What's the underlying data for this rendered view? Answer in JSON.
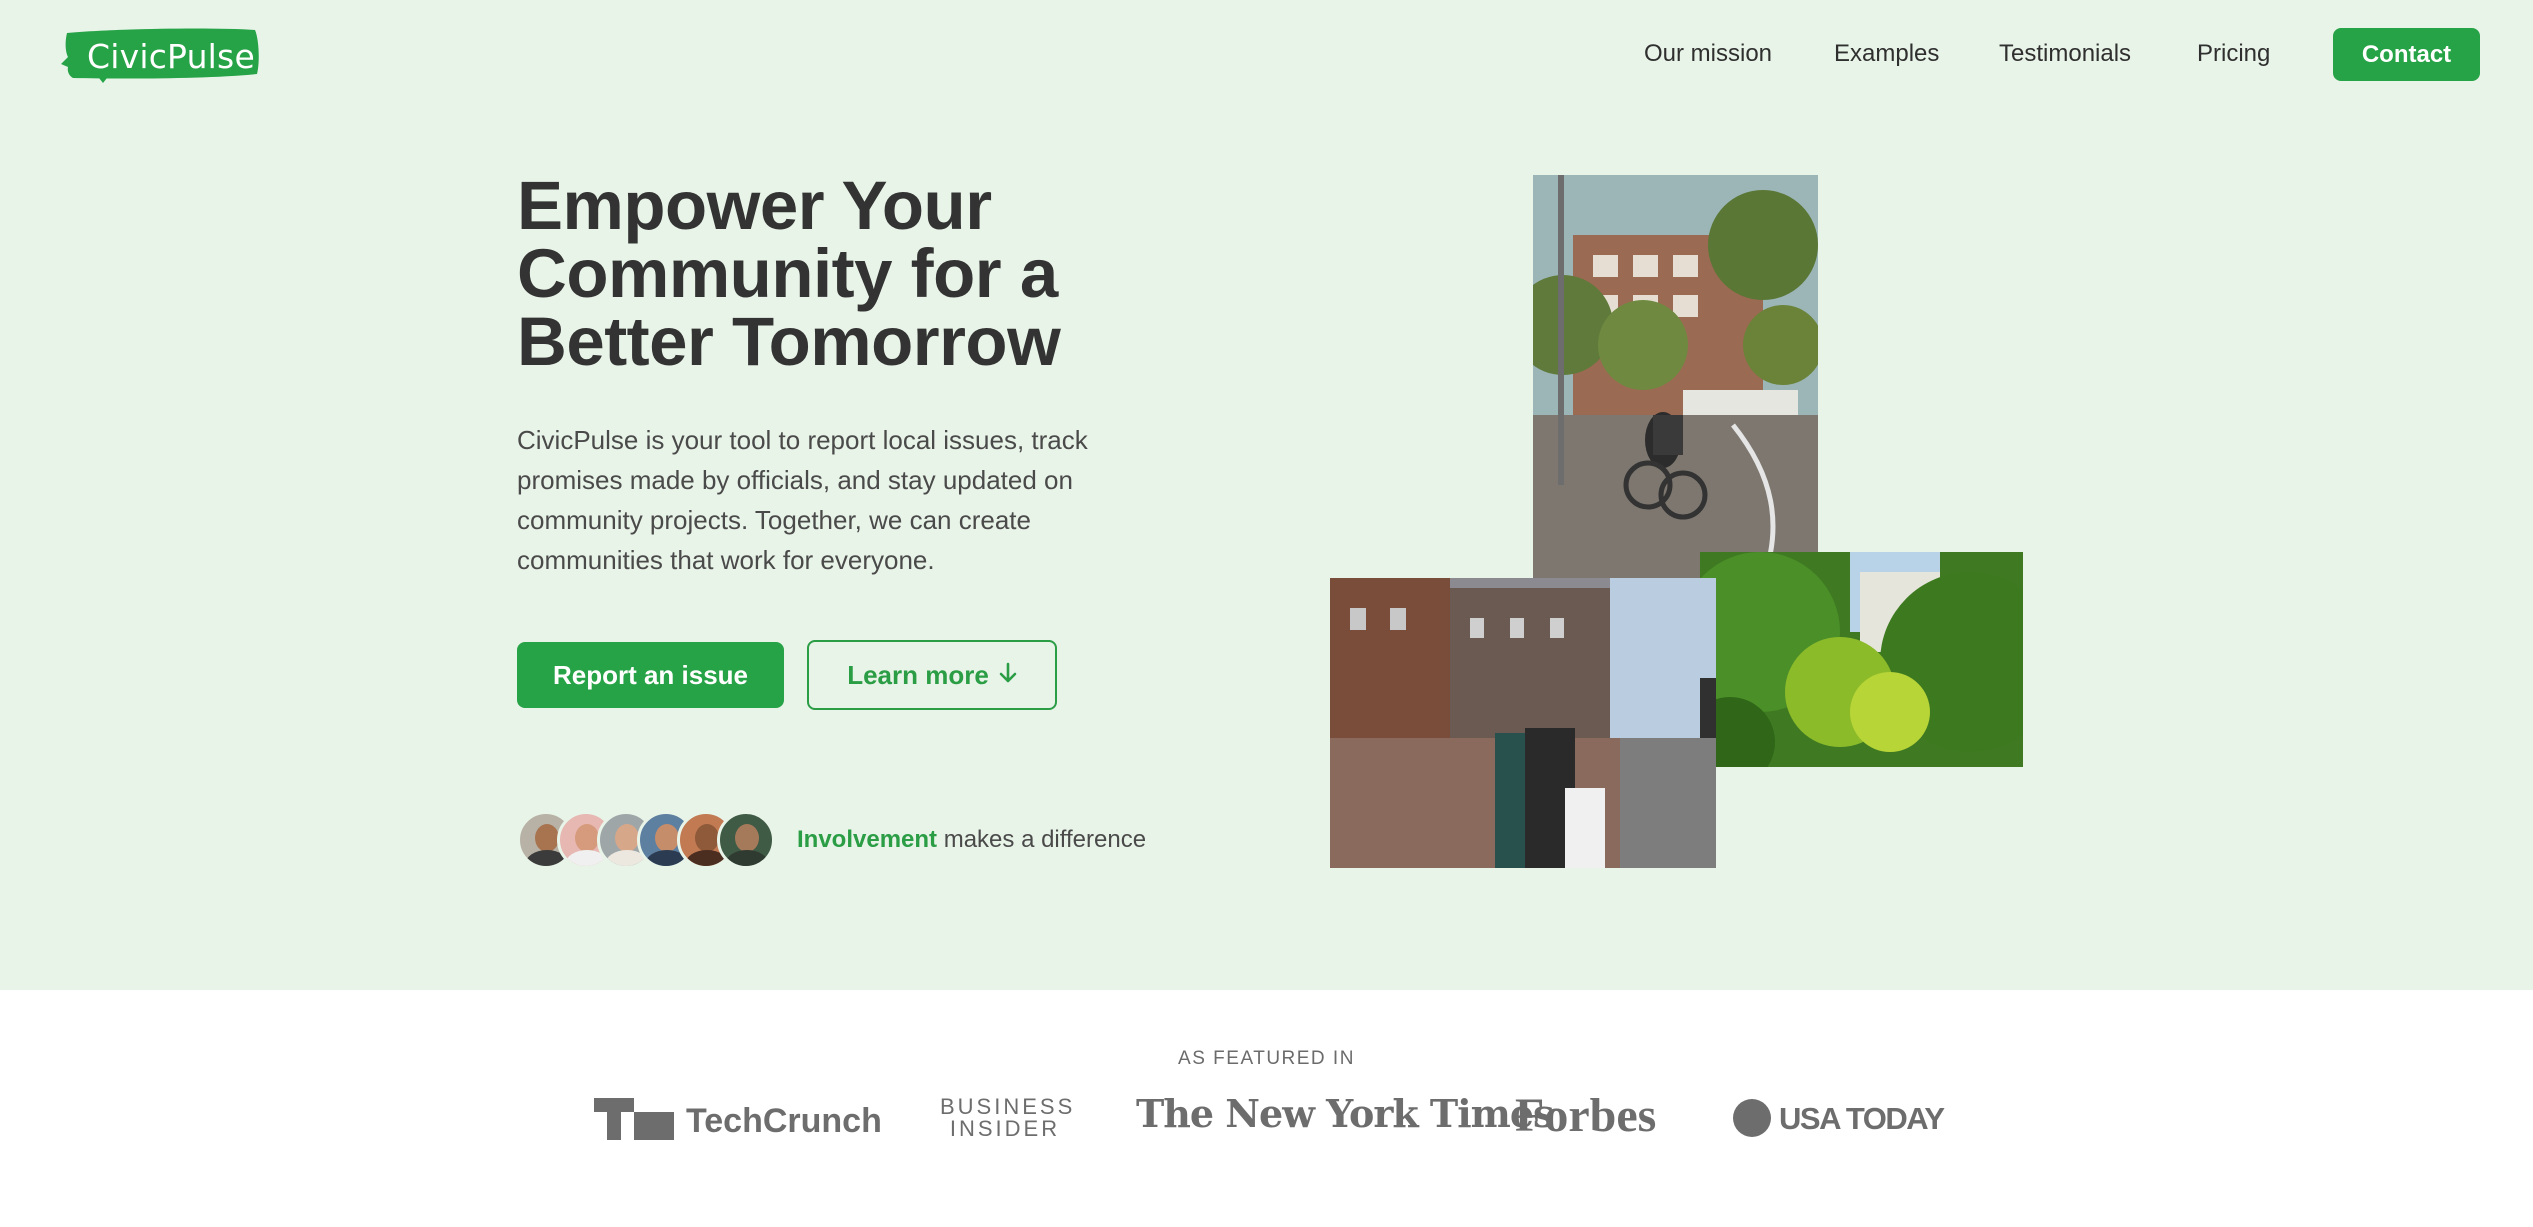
{
  "brand": {
    "name": "CivicPulse",
    "color": "#26a346"
  },
  "nav": {
    "links": [
      "Our mission",
      "Examples",
      "Testimonials",
      "Pricing"
    ],
    "contact": "Contact"
  },
  "hero": {
    "headline_lines": [
      "Empower Your",
      "Community for a",
      "Better Tomorrow"
    ],
    "subtext": "CivicPulse is your tool to report local issues, track promises made by officials, and stay updated on community projects. Together, we can create communities that work for everyone.",
    "primary_cta": "Report an issue",
    "secondary_cta": "Learn more",
    "secondary_cta_icon": "arrow-down-icon",
    "involvement_highlight": "Involvement",
    "involvement_rest": " makes a difference"
  },
  "featured": {
    "label": "AS FEATURED IN",
    "outlets": [
      "TechCrunch",
      "BUSINESS",
      "INSIDER",
      "The New York Times",
      "Forbes",
      "USA TODAY"
    ]
  },
  "colors": {
    "hero_bg": "#e9f4e9",
    "accent": "#26a346",
    "text": "#333333"
  }
}
